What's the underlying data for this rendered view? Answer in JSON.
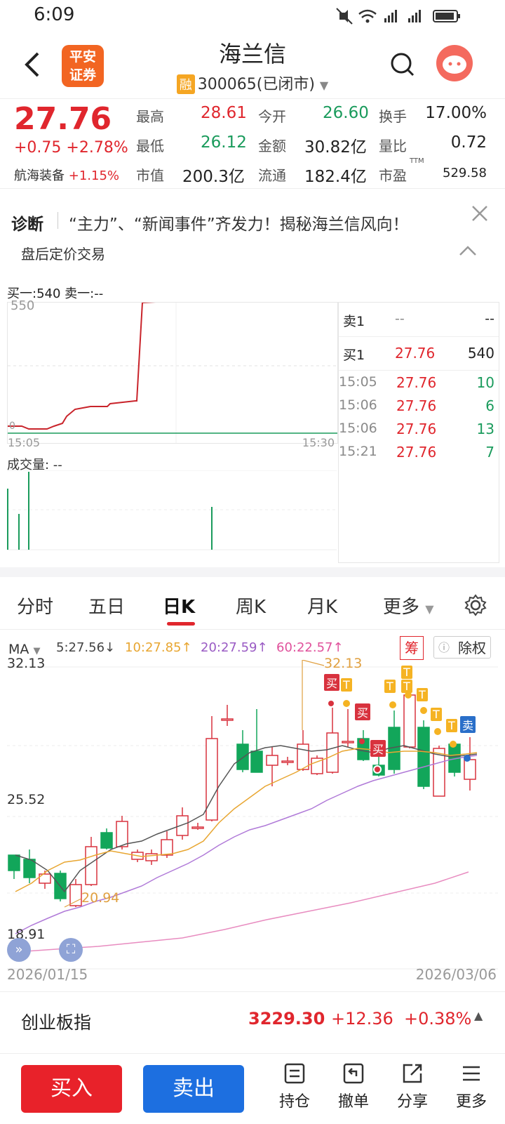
{
  "status": {
    "time": "6:09"
  },
  "header": {
    "title": "海兰信",
    "code": "300065",
    "state": "(已闭市)",
    "rong": "融",
    "logo_line1": "平安",
    "logo_line2": "证券"
  },
  "quote": {
    "price": "27.76",
    "change": "+0.75",
    "change_pct": "+2.78%",
    "sector": "航海装备",
    "sector_pct": "+1.15%",
    "high_label": "最高",
    "high": "28.61",
    "open_label": "今开",
    "open": "26.60",
    "turnover_label": "换手",
    "turnover": "17.00%",
    "low_label": "最低",
    "low": "26.12",
    "amount_label": "金额",
    "amount": "30.82亿",
    "vr_label": "量比",
    "vr": "0.72",
    "mcap_label": "市值",
    "mcap": "200.3亿",
    "float_label": "流通",
    "float": "182.4亿",
    "pe_label": "市盈",
    "pe_sup": "TTM",
    "pe": "529.58"
  },
  "diagnosis": {
    "label": "诊断",
    "text": "“主力”、“新闻事件”齐发力！揭秘海兰信风向！",
    "sub": "盘后定价交易"
  },
  "after_hours": {
    "buy_sell": "买一:540 卖一:--",
    "top_label": "550",
    "bottom_label": "0",
    "t_start": "15:05",
    "t_end": "15:30",
    "volume_label": "成交量: --",
    "sell1_label": "卖1",
    "sell1_price": "--",
    "sell1_qty": "--",
    "buy1_label": "买1",
    "buy1_price": "27.76",
    "buy1_qty": "540",
    "trades": [
      {
        "time": "15:05",
        "price": "27.76",
        "qty": "10"
      },
      {
        "time": "15:06",
        "price": "27.76",
        "qty": "6"
      },
      {
        "time": "15:06",
        "price": "27.76",
        "qty": "13"
      },
      {
        "time": "15:21",
        "price": "27.76",
        "qty": "7"
      }
    ]
  },
  "tabs": [
    "分时",
    "五日",
    "日K",
    "周K",
    "月K",
    "更多"
  ],
  "active_tab": "日K",
  "kline": {
    "ma_label": "MA",
    "ma5": "5:27.56↓",
    "ma10": "10:27.85↑",
    "ma20": "20:27.59↑",
    "ma60": "60:22.57↑",
    "chip": "筹",
    "fq": "除权",
    "y_top": "32.13",
    "y_mid": "25.52",
    "y_bottom": "18.91",
    "hi_marker": "32.13",
    "lo_marker": "20.94",
    "date_start": "2026/01/15",
    "date_end": "2026/03/06",
    "buy_tag": "买",
    "sell_tag": "卖",
    "t_tag": "T"
  },
  "index": {
    "name": "创业板指",
    "value": "3229.30",
    "change": "+12.36",
    "pct": "+0.38%"
  },
  "bottom": {
    "buy": "买入",
    "sell": "卖出",
    "hold": "持仓",
    "cancel": "撤单",
    "share": "分享",
    "more": "更多"
  },
  "colors": {
    "up": "#e0262d",
    "down": "#1a9b5c",
    "brand": "#f26522",
    "buy_btn": "#e8222a",
    "sell_btn": "#1d6fe0"
  }
}
